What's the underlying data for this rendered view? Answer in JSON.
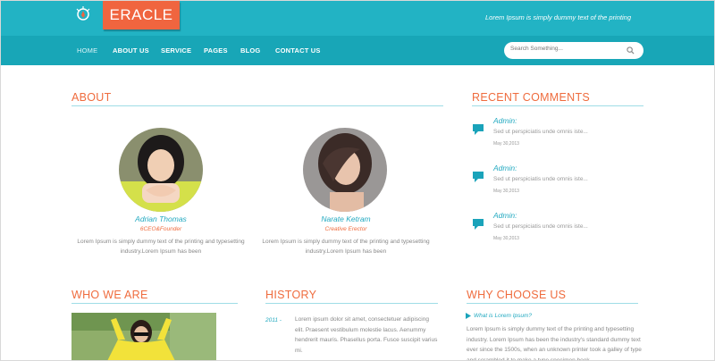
{
  "header": {
    "logo_text": "ERACLE",
    "tagline": "Lorem Ipsum is simply dummy text of the printing"
  },
  "nav": {
    "items": [
      {
        "label": "HOME"
      },
      {
        "label": "ABOUT US"
      },
      {
        "label": "SERVICE"
      },
      {
        "label": "PAGES"
      },
      {
        "label": "BLOG"
      },
      {
        "label": "CONTACT US"
      }
    ],
    "search_placeholder": "Search Something..."
  },
  "about": {
    "title": "ABOUT",
    "people": [
      {
        "name": "Adrian Thomas",
        "role": "6CEO&Founder",
        "desc_line1": "Lorem Ipsum is simply dummy text of the printing and typesetting",
        "desc_line2": "industry.Lorem Ipsum has been"
      },
      {
        "name": "Narate Ketram",
        "role": "Creative Erector",
        "desc_line1": "Lorem Ipsum is simply dummy text of the printing and typesetting",
        "desc_line2": "industry.Lorem Ipsum has been"
      }
    ]
  },
  "comments": {
    "title": "RECENT COMMENTS",
    "items": [
      {
        "author": "Admin:",
        "text": "Sed ut perspiciatis unde omnis iste...",
        "date": "May 30,2013"
      },
      {
        "author": "Admin:",
        "text": "Sed ut perspiciatis unde omnis iste...",
        "date": "May 30,2013"
      },
      {
        "author": "Admin:",
        "text": "Sed ut perspiciatis unde omnis iste...",
        "date": "May 30,2013"
      }
    ]
  },
  "who": {
    "title": "WHO WE ARE"
  },
  "history": {
    "title": "HISTORY",
    "year": "2011 -",
    "text": "Lorem ipsum dolor sit amet, consectetuer adipiscing elit. Praesent vestibulum molestie lacus. Aenummy hendrerit mauris. Phasellus porta. Fusce suscipit varius mi."
  },
  "why": {
    "title": "WHY CHOOSE US",
    "link": "What is Lorem Ipsum?",
    "text": "Lorem Ipsum is simply dummy text of the printing and typesetting industry. Lorem Ipsum has been the industry's standard dummy text ever since the 1500s, when an unknown printer took a galley of type and scrambled it to make a type specimen book."
  },
  "colors": {
    "topbar": "#22b3c4",
    "navbar": "#18a6b7",
    "accent_orange": "#ef6c3e",
    "accent_teal": "#22a9c0"
  }
}
